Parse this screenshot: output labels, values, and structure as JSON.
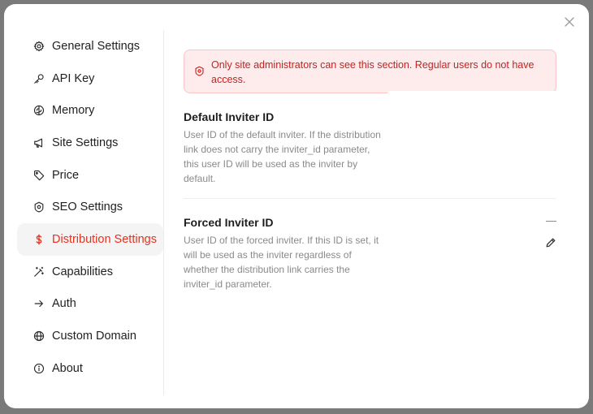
{
  "sidebar": {
    "items": [
      {
        "label": "General Settings",
        "icon": "gear-icon"
      },
      {
        "label": "API Key",
        "icon": "key-icon"
      },
      {
        "label": "Memory",
        "icon": "brain-icon"
      },
      {
        "label": "Site Settings",
        "icon": "megaphone-icon"
      },
      {
        "label": "Price",
        "icon": "tag-icon"
      },
      {
        "label": "SEO Settings",
        "icon": "shield-icon"
      },
      {
        "label": "Distribution Settings",
        "icon": "dollar-icon"
      },
      {
        "label": "Capabilities",
        "icon": "magic-wand-icon"
      },
      {
        "label": "Auth",
        "icon": "arrow-right-icon"
      },
      {
        "label": "Custom Domain",
        "icon": "globe-icon"
      },
      {
        "label": "About",
        "icon": "info-icon"
      }
    ],
    "active": "Distribution Settings"
  },
  "alert": {
    "text": "Only site administrators can see this section. Regular users do not have access.",
    "icon": "shield-alert-icon"
  },
  "settings": {
    "default_inviter": {
      "title": "Default Inviter ID",
      "description": "User ID of the default inviter. If the distribution link does not carry the inviter_id parameter, this user ID will be used as the inviter by default."
    },
    "forced_inviter": {
      "title": "Forced Inviter ID",
      "description": "User ID of the forced inviter. If this ID is set, it will be used as the inviter regardless of whether the distribution link carries the inviter_id parameter.",
      "value": "—"
    }
  },
  "colors": {
    "accent": "#e5321e",
    "alert_bg": "#feeced",
    "alert_text": "#c5221f",
    "muted_text": "#8a8a8a"
  }
}
